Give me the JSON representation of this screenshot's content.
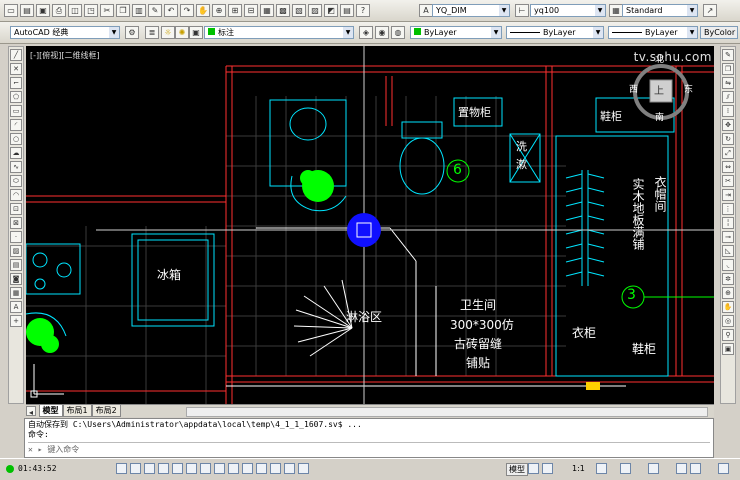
{
  "toolbar1": {
    "dimstyle": "YQ_DIM",
    "textstyle": "yq100",
    "tablestyle": "Standard"
  },
  "toolbar2": {
    "workspace": "AutoCAD 经典",
    "layer_name": "标注",
    "color": "ByLayer",
    "linetype": "ByLayer",
    "lineweight": "ByLayer",
    "plotstyle": "ByColor"
  },
  "viewport_label": "[-][俯视][二维线框]",
  "watermark": "tv.sohu.com",
  "viewcube": {
    "north": "北",
    "south": "南",
    "east": "东",
    "west": "西",
    "face": "上"
  },
  "drawing": {
    "labels": {
      "display_cabinet": "置物柜",
      "shoe_cabinet": "鞋柜",
      "shoe_cabinet2": "鞋柜",
      "fridge": "冰箱",
      "shower": "淋浴区",
      "bathroom_l1": "卫生间",
      "bathroom_l2": "300*300仿",
      "bathroom_l3": "古砖留缝",
      "bathroom_l4": "铺贴",
      "wardrobe": "衣柜",
      "cloakroom": "衣帽间",
      "floor_l1": "实木地板满铺",
      "wash_char1": "洗",
      "wash_char2": "漱",
      "marker_6": "6",
      "marker_3": "3"
    }
  },
  "tabs": [
    "模型",
    "布局1",
    "布局2"
  ],
  "command": {
    "line1": "自动保存到 C:\\Users\\Administrator\\appdata\\local\\temp\\4_1_1_1607.sv$ ...",
    "line2": "命令:",
    "prompt": "键入命令"
  },
  "status": {
    "time": "01:43:52",
    "space": "模型",
    "scale": "1:1"
  },
  "colors": {
    "canvas_bg": "#000000",
    "cyan": "#00e5ff",
    "green": "#00ff00",
    "wall": "#ff3030",
    "white": "#ffffff"
  }
}
